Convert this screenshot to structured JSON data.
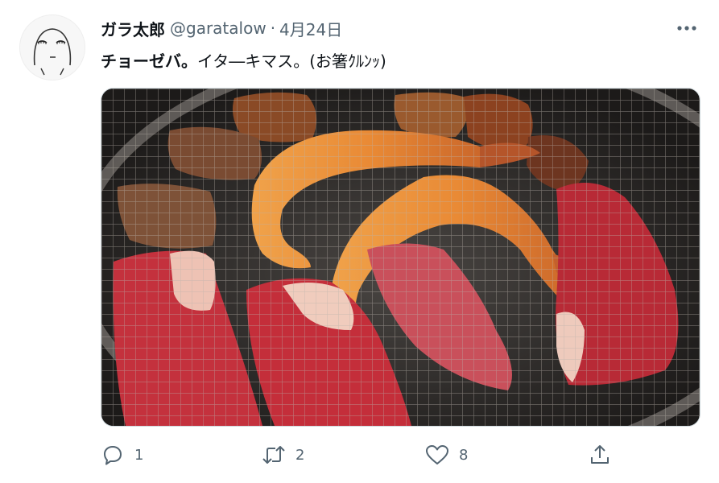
{
  "tweet": {
    "display_name": "ガラ太郎",
    "handle": "@garatalow",
    "separator": "·",
    "date": "4月24日",
    "text_bold": "チョーゼバ。",
    "text_rest": "イタ―キマス。(お箸ｸﾙﾝｯ)",
    "media_alt": "photo",
    "avatar_icon": "cartoon-face-avatar",
    "more_icon": "more-dots-icon"
  },
  "actions": {
    "reply_count": "1",
    "retweet_count": "2",
    "like_count": "8"
  },
  "colors": {
    "text": "#0f1419",
    "secondary": "#536471",
    "border": "#cfd9de"
  }
}
